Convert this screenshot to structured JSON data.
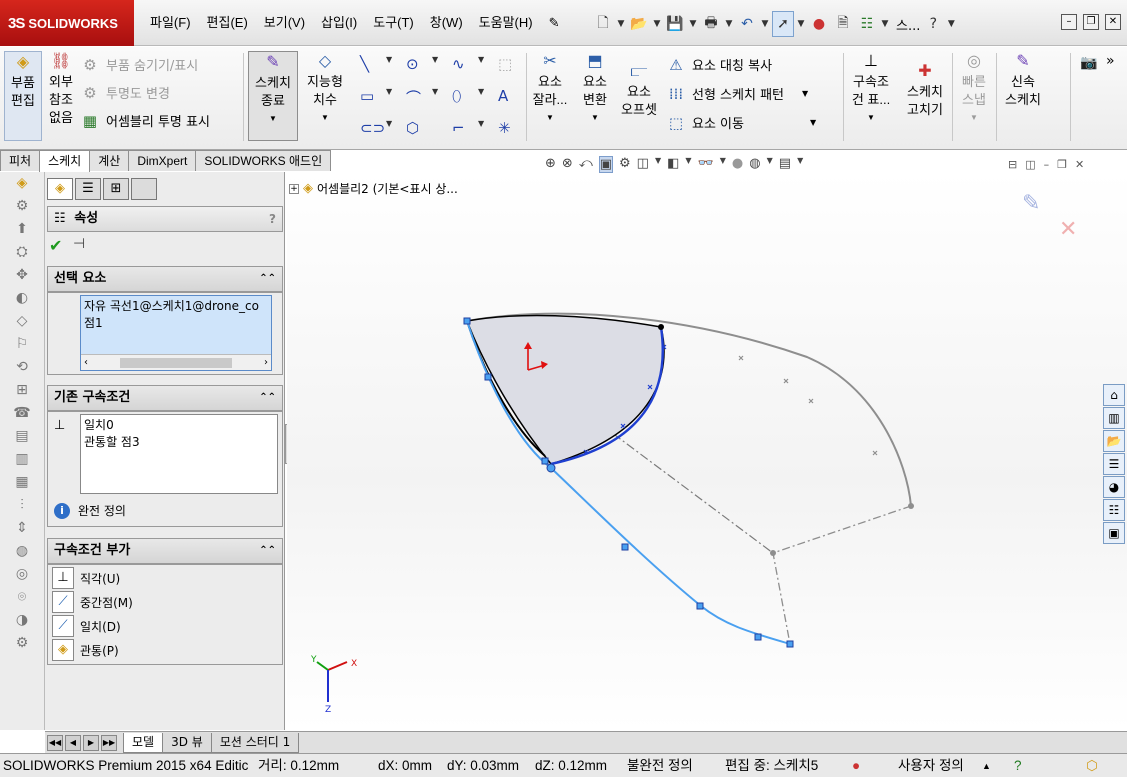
{
  "app": {
    "logo_ds": "3S",
    "logo_name": "SOLIDWORKS",
    "search_label": "스..."
  },
  "menu": [
    {
      "label": "파일(F)"
    },
    {
      "label": "편집(E)"
    },
    {
      "label": "보기(V)"
    },
    {
      "label": "삽입(I)"
    },
    {
      "label": "도구(T)"
    },
    {
      "label": "창(W)"
    },
    {
      "label": "도움말(H)"
    }
  ],
  "ribbon": {
    "edit_part": "부품\n편집",
    "external_refs": "외부\n참조\n없음",
    "hide_show_parts": "부품 숨기기/표시",
    "change_transparency": "투명도 변경",
    "assembly_transparency": "어셈블리 투명 표시",
    "exit_sketch": "스케치\n종료",
    "smart_dimension": "지능형\n치수",
    "trim": "요소\n잘라...",
    "convert": "요소\n변환",
    "offset": "요소\n오프셋",
    "mirror": "요소 대칭 복사",
    "linear_pattern": "선형 스케치 패턴",
    "move": "요소 이동",
    "display_relations": "구속조\n건 표...",
    "repair_sketch": "스케치\n고치기",
    "quick_snaps": "빠른\n스냅",
    "rapid_sketch": "신속\n스케치"
  },
  "cmd_tabs": [
    {
      "label": "피처",
      "active": false
    },
    {
      "label": "스케치",
      "active": true
    },
    {
      "label": "계산",
      "active": false
    },
    {
      "label": "DimXpert",
      "active": false
    },
    {
      "label": "SOLIDWORKS 애드인",
      "active": false
    }
  ],
  "property_manager": {
    "title": "속성",
    "help": "?",
    "selected_entities": {
      "title": "선택 요소",
      "items": [
        "자유 곡선1@스케치1@drone_co",
        "점1"
      ]
    },
    "existing_relations": {
      "title": "기존 구속조건",
      "items": [
        "일치0",
        "관통할 점3"
      ],
      "status": "완전 정의"
    },
    "add_relations": {
      "title": "구속조건 부가",
      "items": [
        {
          "label": "직각(U)",
          "icon": "perpendicular-icon"
        },
        {
          "label": "중간점(M)",
          "icon": "midpoint-icon"
        },
        {
          "label": "일치(D)",
          "icon": "coincident-icon"
        },
        {
          "label": "관통(P)",
          "icon": "pierce-icon"
        }
      ]
    }
  },
  "viewport": {
    "tree_root": "어셈블리2 (기본<표시 상..."
  },
  "bottom_tabs": [
    {
      "label": "모델",
      "active": true
    },
    {
      "label": "3D 뷰",
      "active": false
    },
    {
      "label": "모션 스터디 1",
      "active": false
    }
  ],
  "status": {
    "product": "SOLIDWORKS Premium 2015 x64 Editic",
    "distance": "거리: 0.12mm",
    "dx": "dX: 0mm",
    "dy": "dY: 0.03mm",
    "dz": "dZ: 0.12mm",
    "definition": "불완전 정의",
    "editing": "편집 중: 스케치5",
    "custom": "사용자 정의"
  },
  "colors": {
    "logo_red": "#c41e16",
    "selection_blue": "#1f3fd0",
    "curve_light_blue": "#4aa0f0",
    "accent_blue": "#cfe4fa"
  }
}
